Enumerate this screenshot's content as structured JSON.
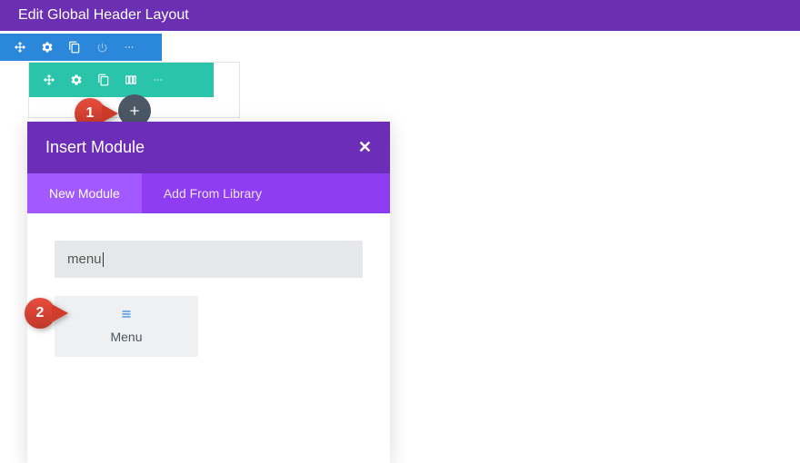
{
  "header": {
    "title": "Edit Global Header Layout"
  },
  "modal": {
    "title": "Insert Module",
    "close": "✕",
    "tabs": {
      "new_module": "New Module",
      "add_from_library": "Add From Library"
    },
    "search_value": "menu",
    "result": {
      "label": "Menu"
    }
  },
  "callouts": {
    "one": "1",
    "two": "2"
  }
}
